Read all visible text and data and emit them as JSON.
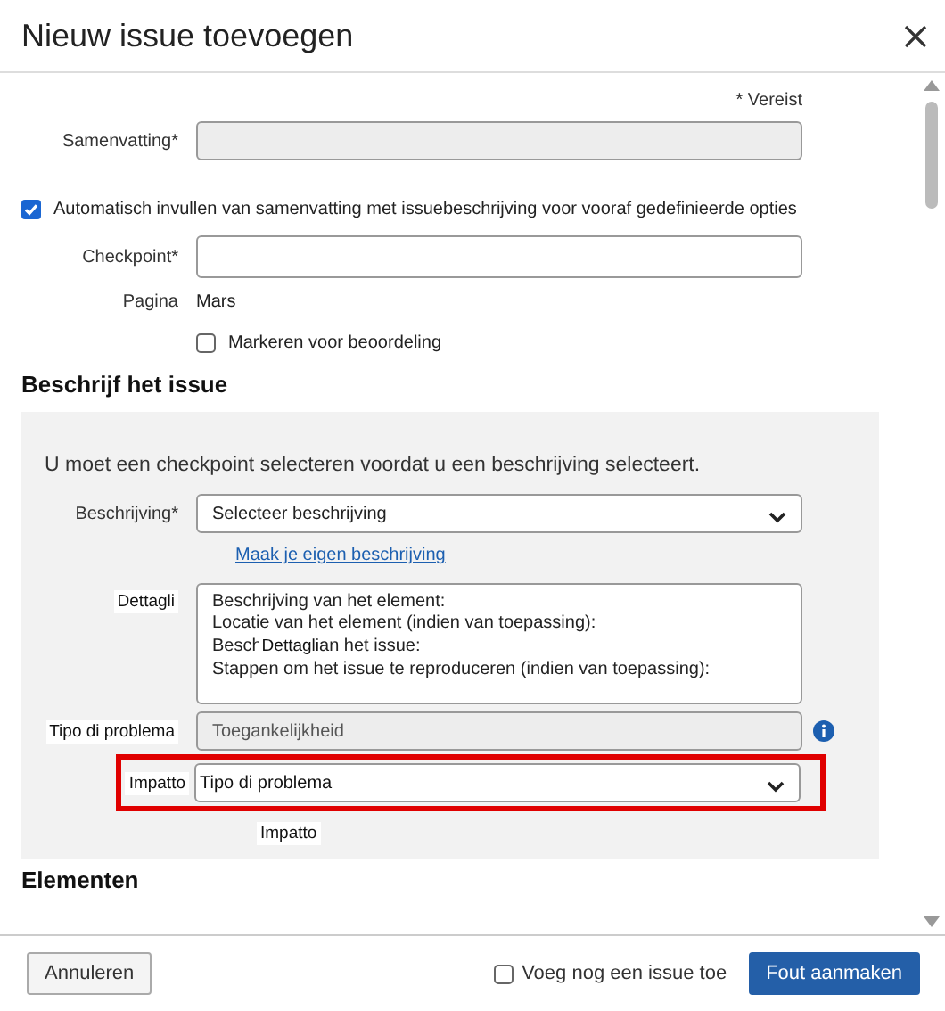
{
  "window": {
    "title": "Nieuw issue toevoegen"
  },
  "required_note": "* Vereist",
  "summary": {
    "label": "Samenvatting*",
    "disabled": true
  },
  "autofill": {
    "label": "Automatisch invullen van samenvatting met issuebeschrijving voor vooraf gedefinieerde opties",
    "checked": true
  },
  "checkpoint": {
    "label": "Checkpoint*",
    "disabled": false
  },
  "page": {
    "label": "Pagina",
    "value": "Mars"
  },
  "mark_for_review": {
    "label": "Markeren voor beoordeling",
    "checked": false
  },
  "section_heading": "Beschrijf het issue",
  "panel": {
    "message": "U moet een checkpoint selecteren voordat u een beschrijving selecteert.",
    "description": {
      "label": "Beschrijving*",
      "value": "Selecteer beschrijving"
    },
    "link": "Maak je eigen beschrijving",
    "details": {
      "label": "Dettagli",
      "lines": [
        {
          "kind": "text",
          "text": "Beschrijving van het element:"
        },
        {
          "kind": "text",
          "text": "Locatie van het element (indien van toepassing):"
        },
        {
          "kind": "covered",
          "start": "Besch",
          "tag": "Dettagli",
          "end": "an het issue:"
        },
        {
          "kind": "text",
          "text": "Stappen om het issue te reproduceren (indien van toepassing):"
        }
      ]
    },
    "issue_type": {
      "label": "Tipo di problema",
      "value": "Toegankelijkheid",
      "disabled": true
    },
    "impact": {
      "label": "Impatto",
      "value": "Tipo di problema",
      "highlighted": true
    },
    "floating_label": "Impatto"
  },
  "next_heading": "Elementen",
  "footer": {
    "cancel": "Annuleren",
    "add_another": {
      "label": "Voeg nog een issue toe",
      "checked": false
    },
    "submit": "Fout aanmaken"
  }
}
